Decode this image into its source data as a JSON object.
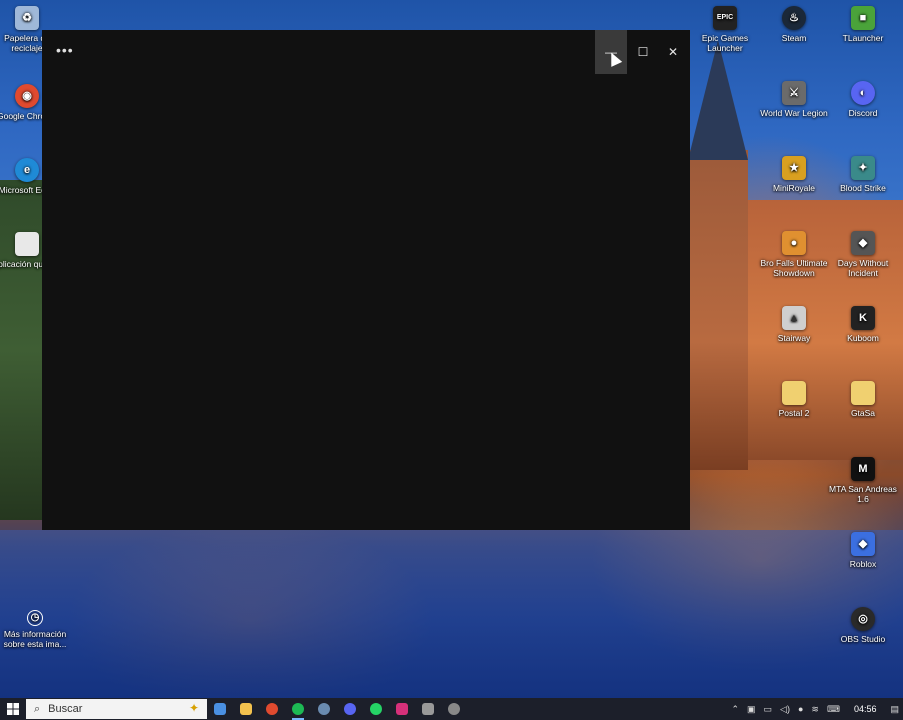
{
  "window": {
    "more_label": "•••",
    "minimize_label": "—",
    "maximize_label": "☐",
    "close_label": "✕"
  },
  "desktop_left": [
    {
      "name": "recycle-bin",
      "label": "Papelera de reciclaje",
      "color": "#9fb8d8",
      "glyph": "♻"
    },
    {
      "name": "google-chrome",
      "label": "Google Chrome",
      "color": "#e04a2f",
      "glyph": "◉"
    },
    {
      "name": "microsoft-edge",
      "label": "Microsoft Edge",
      "color": "#1f8ad6",
      "glyph": "e"
    },
    {
      "name": "aplicacion-quitada",
      "label": "Aplicación quitada",
      "color": "#e8e8e8",
      "glyph": ""
    }
  ],
  "desktop_right": [
    {
      "name": "epic-games-launcher",
      "label": "Epic Games Launcher",
      "color": "#222222",
      "glyph": "EPIC"
    },
    {
      "name": "steam",
      "label": "Steam",
      "color": "#1b2838",
      "glyph": "♨"
    },
    {
      "name": "tlauncher",
      "label": "TLauncher",
      "color": "#4aa33a",
      "glyph": "■"
    },
    {
      "name": "world-war-legion",
      "label": "World War Legion",
      "color": "#6b6b6b",
      "glyph": "⚔"
    },
    {
      "name": "discord",
      "label": "Discord",
      "color": "#5865f2",
      "glyph": "◐"
    },
    {
      "name": "miniroyale",
      "label": "MiniRoyale",
      "color": "#d9a020",
      "glyph": "★"
    },
    {
      "name": "blood-strike",
      "label": "Blood Strike",
      "color": "#3a8a8a",
      "glyph": "✦"
    },
    {
      "name": "bro-falls",
      "label": "Bro Falls Ultimate Showdown",
      "color": "#e09030",
      "glyph": "●"
    },
    {
      "name": "days-without-incident",
      "label": "Days Without Incident",
      "color": "#555555",
      "glyph": "◆"
    },
    {
      "name": "stairway",
      "label": "Stairway",
      "color": "#cfcfcf",
      "glyph": "▲"
    },
    {
      "name": "kuboom",
      "label": "Kuboom",
      "color": "#222222",
      "glyph": "K"
    },
    {
      "name": "postal-2",
      "label": "Postal 2",
      "color": "#f0d070",
      "glyph": ""
    },
    {
      "name": "gtasa",
      "label": "GtaSa",
      "color": "#f0d070",
      "glyph": ""
    },
    {
      "name": "mta-san-andreas",
      "label": "MTA San Andreas 1.6",
      "color": "#111111",
      "glyph": "M"
    },
    {
      "name": "roblox",
      "label": "Roblox",
      "color": "#3b6fe0",
      "glyph": "◆"
    },
    {
      "name": "obs-studio",
      "label": "OBS Studio",
      "color": "#2a2a2a",
      "glyph": "◎"
    }
  ],
  "spotlight": {
    "label": "Más información sobre esta ima...",
    "glyph": "◷"
  },
  "taskbar": {
    "search_placeholder": "Buscar",
    "apps": [
      {
        "name": "task-view",
        "color": "#4a90e2"
      },
      {
        "name": "file-explorer",
        "color": "#f2c14e"
      },
      {
        "name": "chrome",
        "color": "#e04a2f"
      },
      {
        "name": "spotify",
        "color": "#1db954",
        "active": true
      },
      {
        "name": "steam",
        "color": "#6a8bb0"
      },
      {
        "name": "discord",
        "color": "#5865f2"
      },
      {
        "name": "whatsapp",
        "color": "#25d366"
      },
      {
        "name": "instagram",
        "color": "#d6307a"
      },
      {
        "name": "epic-games",
        "color": "#999999"
      },
      {
        "name": "obs",
        "color": "#888888"
      }
    ],
    "clock": "04:56"
  }
}
